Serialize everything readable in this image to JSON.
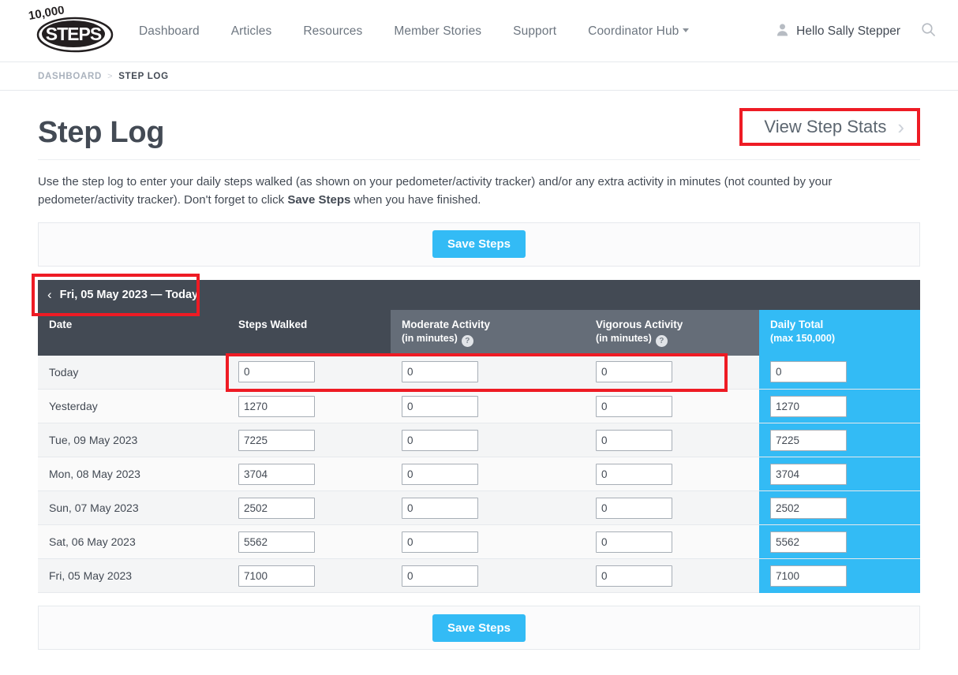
{
  "header": {
    "logo_text": "10,000 STEPS",
    "nav": [
      {
        "label": "Dashboard",
        "has_caret": false
      },
      {
        "label": "Articles",
        "has_caret": false
      },
      {
        "label": "Resources",
        "has_caret": false
      },
      {
        "label": "Member Stories",
        "has_caret": false
      },
      {
        "label": "Support",
        "has_caret": false
      },
      {
        "label": "Coordinator Hub",
        "has_caret": true
      }
    ],
    "greeting": "Hello Sally Stepper",
    "avatar_icon": "user-icon",
    "search_icon": "search-icon"
  },
  "breadcrumb": {
    "parent": "DASHBOARD",
    "separator": ">",
    "current": "STEP LOG"
  },
  "page": {
    "title": "Step Log",
    "stats_button_label": "View Step Stats",
    "stats_button_chevron": "›",
    "intro_part1": "Use the step log to enter your daily steps walked (as shown on your pedometer/activity tracker) and/or any extra activity in minutes (not counted by your pedometer/activity tracker). Don't forget to click ",
    "intro_bold": "Save Steps",
    "intro_part2": " when you have finished.",
    "save_label": "Save Steps",
    "save_label_bottom": "Save Steps"
  },
  "date_nav": {
    "chevron": "‹",
    "label": "Fri, 05 May 2023 — Today"
  },
  "table": {
    "columns": [
      {
        "label": "Date",
        "sub": ""
      },
      {
        "label": "Steps Walked",
        "sub": ""
      },
      {
        "label": "Moderate Activity",
        "sub": "(in minutes)",
        "help": "?"
      },
      {
        "label": "Vigorous Activity",
        "sub": "(in minutes)",
        "help": "?"
      },
      {
        "label": "Daily Total",
        "sub": "(max 150,000)"
      }
    ],
    "rows": [
      {
        "date": "Today",
        "steps": "0",
        "moderate": "0",
        "vigorous": "0",
        "total": "0"
      },
      {
        "date": "Yesterday",
        "steps": "1270",
        "moderate": "0",
        "vigorous": "0",
        "total": "1270"
      },
      {
        "date": "Tue, 09 May 2023",
        "steps": "7225",
        "moderate": "0",
        "vigorous": "0",
        "total": "7225"
      },
      {
        "date": "Mon, 08 May 2023",
        "steps": "3704",
        "moderate": "0",
        "vigorous": "0",
        "total": "3704"
      },
      {
        "date": "Sun, 07 May 2023",
        "steps": "2502",
        "moderate": "0",
        "vigorous": "0",
        "total": "2502"
      },
      {
        "date": "Sat, 06 May 2023",
        "steps": "5562",
        "moderate": "0",
        "vigorous": "0",
        "total": "5562"
      },
      {
        "date": "Fri, 05 May 2023",
        "steps": "7100",
        "moderate": "0",
        "vigorous": "0",
        "total": "7100"
      }
    ]
  },
  "colors": {
    "accent_blue": "#33bbf5",
    "header_dark": "#434a54",
    "header_light": "#656d78",
    "highlight_red": "#ee1b24"
  }
}
